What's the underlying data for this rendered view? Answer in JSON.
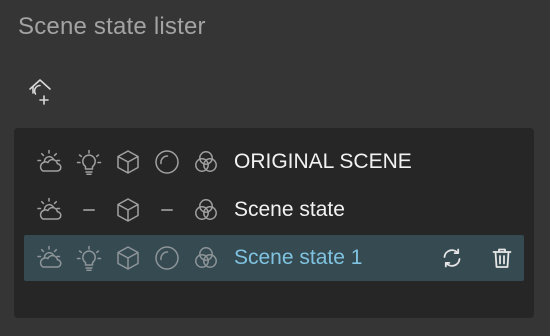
{
  "header": {
    "title": "Scene state lister",
    "add_icon": "add-scene-state-icon"
  },
  "colors": {
    "background": "#353535",
    "panel": "#262626",
    "selected_row": "#364a52",
    "selected_text": "#7fc3e0",
    "text": "#f2f2f2",
    "icon": "#9a9a9a"
  },
  "states": [
    {
      "name": "ORIGINAL SCENE",
      "icons": [
        "environment-icon",
        "lights-icon",
        "geometry-icon",
        "materials-icon",
        "layers-icon"
      ]
    },
    {
      "name": "Scene state",
      "icons": [
        "environment-icon",
        "none",
        "geometry-icon",
        "none",
        "layers-icon"
      ]
    },
    {
      "name": "Scene state 1",
      "selected": true,
      "icons": [
        "environment-icon",
        "lights-icon",
        "geometry-icon",
        "materials-icon",
        "layers-icon"
      ],
      "actions": [
        "update-icon",
        "delete-icon"
      ]
    }
  ]
}
